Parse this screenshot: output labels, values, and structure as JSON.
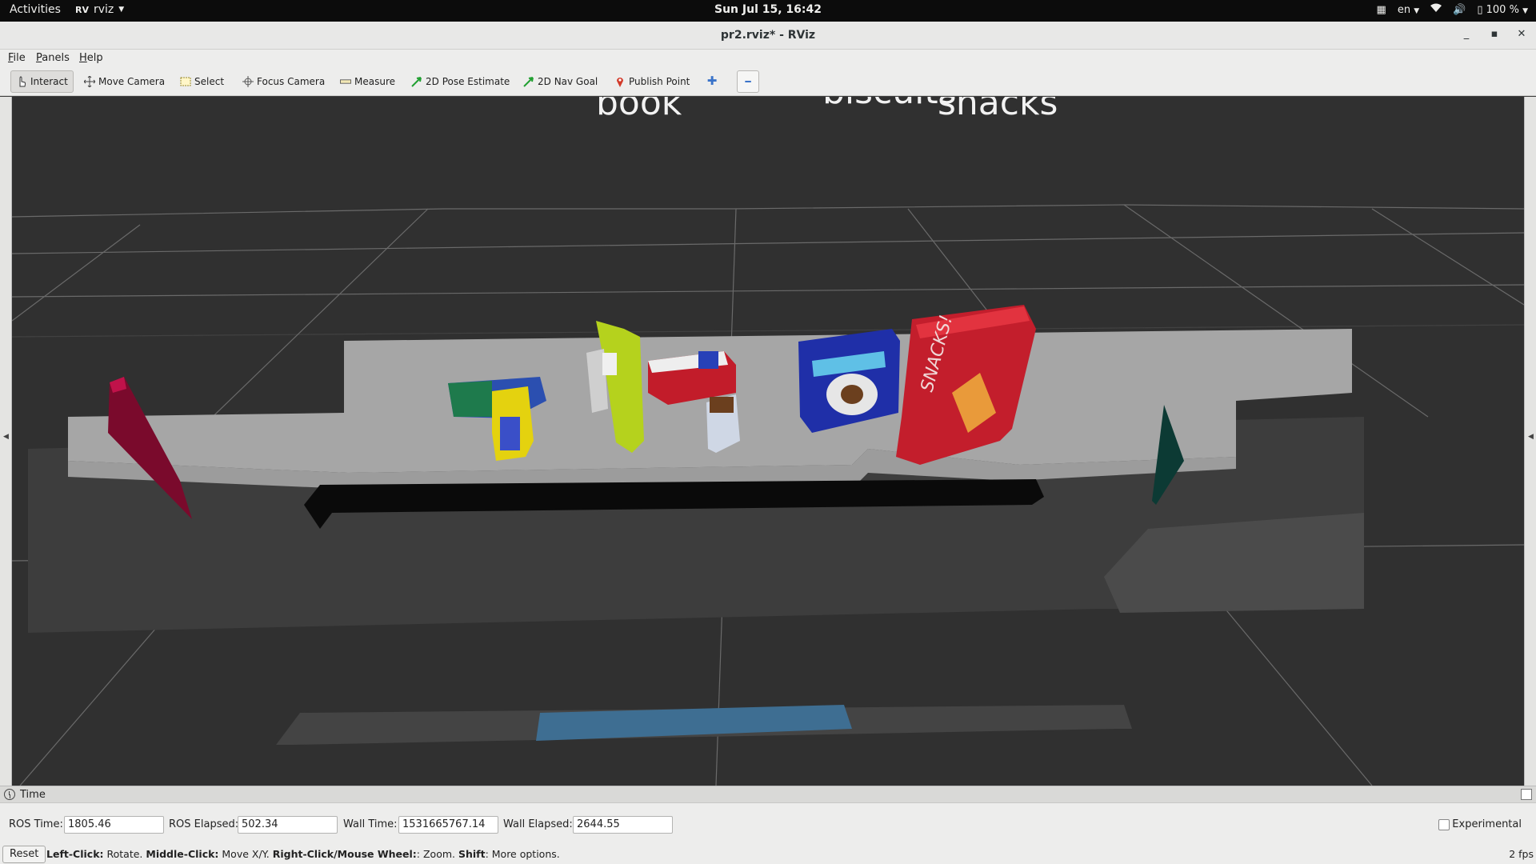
{
  "topbar": {
    "activities": "Activities",
    "app_icon_text": "RV",
    "app_name": "rviz",
    "clock": "Sun Jul 15, 16:42",
    "language": "en",
    "battery": "100 %"
  },
  "window": {
    "title": "pr2.rviz* - RViz"
  },
  "menu": {
    "file": "File",
    "panels": "Panels",
    "help": "Help"
  },
  "toolbar": {
    "interact": "Interact",
    "move_camera": "Move Camera",
    "select": "Select",
    "focus_camera": "Focus Camera",
    "measure": "Measure",
    "pose_estimate": "2D Pose Estimate",
    "nav_goal": "2D Nav Goal",
    "publish_point": "Publish Point",
    "icons": {
      "interact": "hand-pointer-icon",
      "move_camera": "move-arrows-icon",
      "select": "selection-box-icon",
      "focus_camera": "crosshair-icon",
      "measure": "ruler-icon",
      "pose_estimate": "green-arrow-icon",
      "nav_goal": "green-arrow-icon",
      "publish_point": "map-pin-icon",
      "add_tool": "plus-icon",
      "remove_tool": "minus-icon"
    }
  },
  "viewport": {
    "labels": {
      "book": "book",
      "biscuits": "biscuits",
      "snacks": "snacks"
    },
    "colors": {
      "background": "#303030",
      "grid": "#6a6a6a",
      "table": "#a6a6a6",
      "marker_left": "#7a0a2c",
      "marker_right": "#0c3a34"
    }
  },
  "time_panel": {
    "title": "Time",
    "ros_time_label": "ROS Time:",
    "ros_time": "1805.46",
    "ros_elapsed_label": "ROS Elapsed:",
    "ros_elapsed": "502.34",
    "wall_time_label": "Wall Time:",
    "wall_time": "1531665767.14",
    "wall_elapsed_label": "Wall Elapsed:",
    "wall_elapsed": "2644.55",
    "experimental_label": "Experimental"
  },
  "statusbar": {
    "reset": "Reset",
    "hint_left_key": "Left-Click:",
    "hint_left": " Rotate. ",
    "hint_middle_key": "Middle-Click:",
    "hint_middle": " Move X/Y. ",
    "hint_right_key": "Right-Click/Mouse Wheel:",
    "hint_right": ": Zoom. ",
    "hint_shift_key": "Shift",
    "hint_shift": ": More options.",
    "fps": "2 fps"
  }
}
